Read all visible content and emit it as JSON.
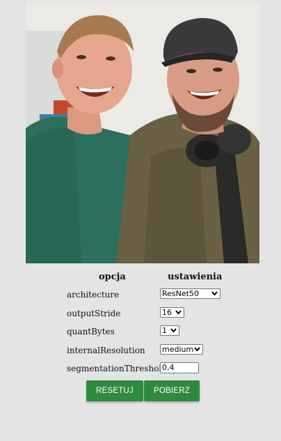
{
  "table": {
    "header_option": "opcja",
    "header_settings": "ustawienia"
  },
  "settings": [
    {
      "label": "architecture",
      "value": "ResNet50",
      "type": "select"
    },
    {
      "label": "outputStride",
      "value": "16",
      "type": "select"
    },
    {
      "label": "quantBytes",
      "value": "1",
      "type": "select"
    },
    {
      "label": "internalResolution",
      "value": "medium",
      "type": "select"
    },
    {
      "label": "segmentationThreshold",
      "value": "0,4",
      "type": "text"
    }
  ],
  "buttons": {
    "reset_label": "RESETUJ",
    "download_label": "POBIERZ"
  },
  "colors": {
    "button_green": "#2e8b3d",
    "page_background": "#e4e4e4"
  }
}
